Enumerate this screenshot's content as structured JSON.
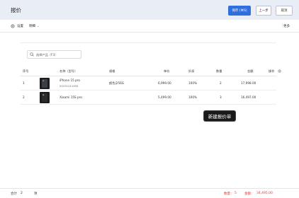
{
  "header": {
    "title": "报价",
    "save_label": "保存 (⌘S)",
    "prev_label": "上一步",
    "cancel_label": "取消"
  },
  "toolbar": {
    "settings_label": "设置",
    "detail_label": "明细",
    "more_label": "更多"
  },
  "search": {
    "text": "选择产品（F3）"
  },
  "table": {
    "columns": [
      "序号",
      "",
      "名称（型号）",
      "规格",
      "单价",
      "折扣",
      "数量",
      "金额",
      "操作"
    ],
    "rows": [
      {
        "index": "1",
        "name": "iPhone 15 pro",
        "model": "20231211932",
        "spec": "颜色|256G",
        "price": "6,999.00",
        "discount": "100%",
        "qty": "2",
        "amount": "17,998.00"
      },
      {
        "index": "2",
        "name": "Xiaomi 15S pro",
        "model": "",
        "spec": "",
        "price": "5,499.00",
        "discount": "100%",
        "qty": "3",
        "amount": "16,497.00"
      }
    ]
  },
  "tooltip": {
    "text": "新建报价单"
  },
  "footer": {
    "total_label": "合计",
    "total_count": "2",
    "unit": "项",
    "qty_label": "数量：",
    "qty_value": "5",
    "amount_label": "金额：",
    "amount_value": "34,495.00"
  },
  "colors": {
    "primary": "#2f6fe0",
    "header_bg": "#e8edf6",
    "total_red": "#e03a3a"
  }
}
